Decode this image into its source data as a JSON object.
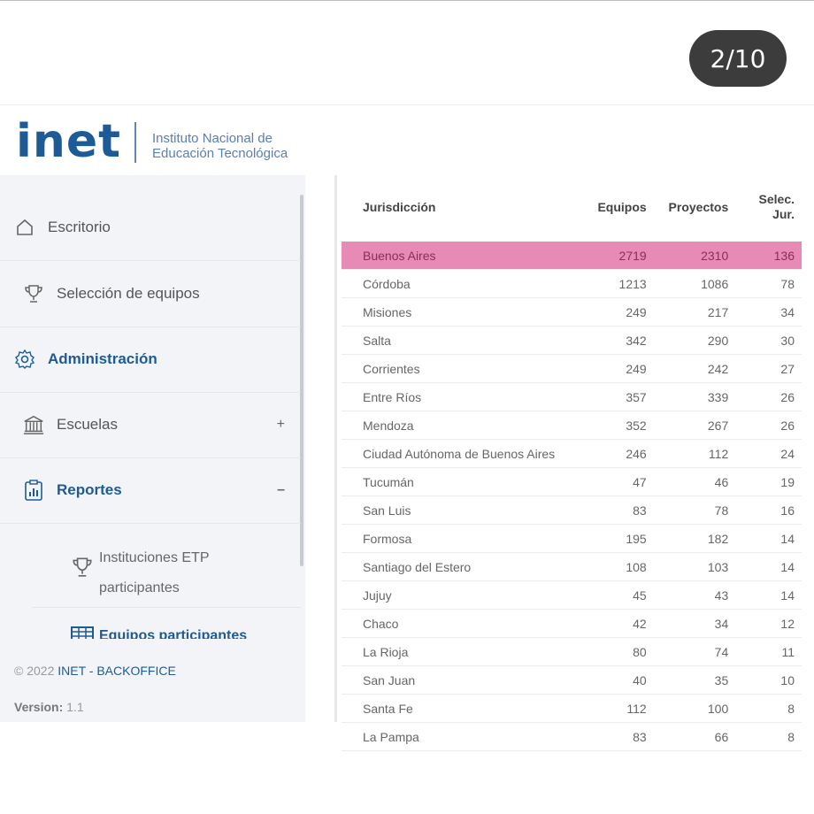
{
  "screen": {
    "counter": "2/10"
  },
  "header": {
    "logo": "inet",
    "subtitle_line1": "Instituto Nacional de",
    "subtitle_line2": "Educación Tecnológica"
  },
  "sidebar": {
    "items": [
      {
        "label": "Escritorio",
        "icon": "home-icon"
      },
      {
        "label": "Selección de equipos",
        "icon": "trophy-icon"
      },
      {
        "label": "Administración",
        "icon": "gear-icon"
      },
      {
        "label": "Escuelas",
        "icon": "bank-icon",
        "toggle": "+"
      },
      {
        "label": "Reportes",
        "icon": "report-icon",
        "toggle": "–"
      }
    ],
    "subitems": [
      {
        "label_line1": "Instituciones ETP",
        "label_line2": "participantes",
        "icon": "trophy-icon"
      },
      {
        "label": "Equipos participantes",
        "icon": "table-icon"
      }
    ],
    "footer": {
      "copyright": "© 2022",
      "brand": "INET - BACKOFFICE",
      "version_label": "Version:",
      "version": "1.1"
    }
  },
  "table": {
    "headers": {
      "jurisdiccion": "Jurisdicción",
      "equipos": "Equipos",
      "proyectos": "Proyectos",
      "selec_line1": "Selec.",
      "selec_line2": "Jur."
    },
    "rows": [
      {
        "name": "Buenos Aires",
        "equipos": "2719",
        "proyectos": "2310",
        "selec": "136"
      },
      {
        "name": "Córdoba",
        "equipos": "1213",
        "proyectos": "1086",
        "selec": "78"
      },
      {
        "name": "Misiones",
        "equipos": "249",
        "proyectos": "217",
        "selec": "34"
      },
      {
        "name": "Salta",
        "equipos": "342",
        "proyectos": "290",
        "selec": "30"
      },
      {
        "name": "Corrientes",
        "equipos": "249",
        "proyectos": "242",
        "selec": "27"
      },
      {
        "name": "Entre Ríos",
        "equipos": "357",
        "proyectos": "339",
        "selec": "26"
      },
      {
        "name": "Mendoza",
        "equipos": "352",
        "proyectos": "267",
        "selec": "26"
      },
      {
        "name": "Ciudad Autónoma de Buenos Aires",
        "equipos": "246",
        "proyectos": "112",
        "selec": "24"
      },
      {
        "name": "Tucumán",
        "equipos": "47",
        "proyectos": "46",
        "selec": "19"
      },
      {
        "name": "San Luis",
        "equipos": "83",
        "proyectos": "78",
        "selec": "16"
      },
      {
        "name": "Formosa",
        "equipos": "195",
        "proyectos": "182",
        "selec": "14"
      },
      {
        "name": "Santiago del Estero",
        "equipos": "108",
        "proyectos": "103",
        "selec": "14"
      },
      {
        "name": "Jujuy",
        "equipos": "45",
        "proyectos": "43",
        "selec": "14"
      },
      {
        "name": "Chaco",
        "equipos": "42",
        "proyectos": "34",
        "selec": "12"
      },
      {
        "name": "La Rioja",
        "equipos": "80",
        "proyectos": "74",
        "selec": "11"
      },
      {
        "name": "San Juan",
        "equipos": "40",
        "proyectos": "35",
        "selec": "10"
      },
      {
        "name": "Santa Fe",
        "equipos": "112",
        "proyectos": "100",
        "selec": "8"
      },
      {
        "name": "La Pampa",
        "equipos": "83",
        "proyectos": "66",
        "selec": "8"
      }
    ],
    "highlight_color": "#e78ab5"
  }
}
